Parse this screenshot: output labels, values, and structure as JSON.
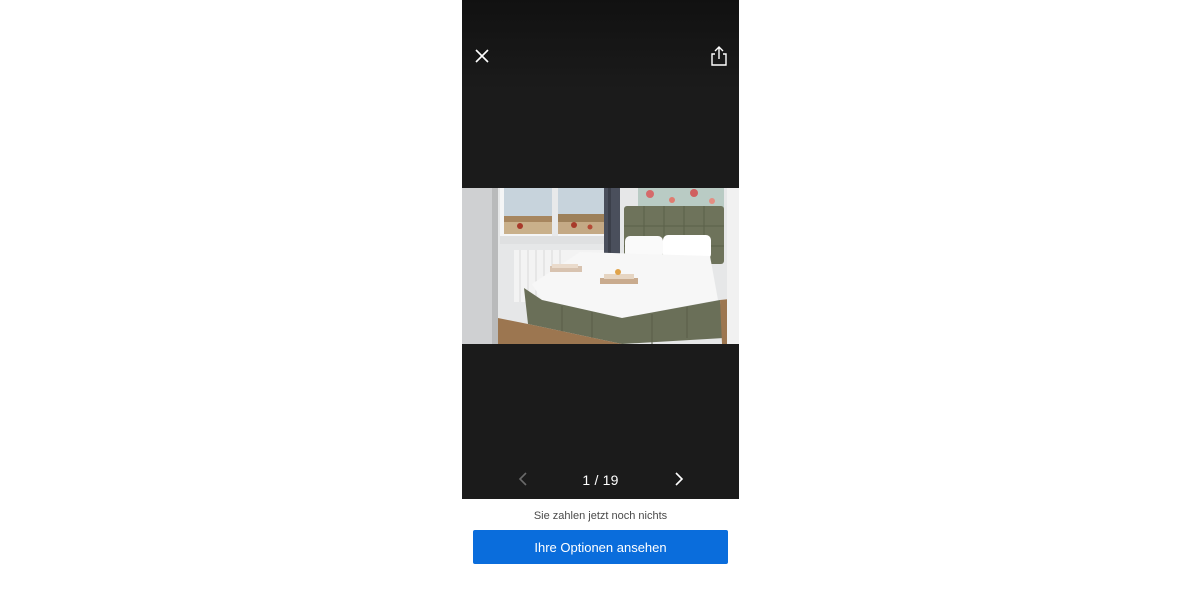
{
  "gallery": {
    "counter_text": "1 / 19",
    "icons": {
      "close": "close-icon",
      "share": "share-icon",
      "prev": "chevron-left-icon",
      "next": "chevron-right-icon"
    },
    "photo_subject": "hotel bedroom with upholstered green bed"
  },
  "footer": {
    "note": "Sie zahlen jetzt noch nichts",
    "cta_label": "Ihre Optionen ansehen"
  },
  "colors": {
    "viewer_bg": "#1b1b1b",
    "cta_bg": "#0a6ddc",
    "cta_text": "#ffffff"
  }
}
